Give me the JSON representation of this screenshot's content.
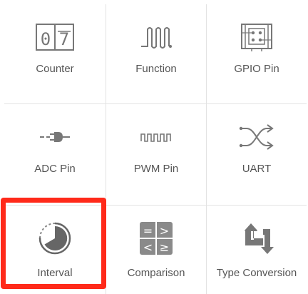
{
  "blocks": [
    {
      "label": "Counter",
      "icon": "counter-icon"
    },
    {
      "label": "Function",
      "icon": "function-icon"
    },
    {
      "label": "GPIO Pin",
      "icon": "gpio-pin-icon"
    },
    {
      "label": "ADC Pin",
      "icon": "adc-pin-icon"
    },
    {
      "label": "PWM Pin",
      "icon": "pwm-pin-icon"
    },
    {
      "label": "UART",
      "icon": "uart-icon"
    },
    {
      "label": "Interval",
      "icon": "interval-icon"
    },
    {
      "label": "Comparison",
      "icon": "comparison-icon"
    },
    {
      "label": "Type Conversion",
      "icon": "type-conversion-icon"
    }
  ],
  "counter_icon": {
    "digit_left": "0",
    "digit_right": "7"
  },
  "comparison_icon": {
    "symbols": [
      "=",
      ">",
      "<",
      "≥"
    ]
  },
  "highlight": {
    "selected": "Interval",
    "color": "#ff2a1a"
  },
  "colors": {
    "icon": "#777777",
    "label": "#555555",
    "divider": "#e3e3e3"
  }
}
